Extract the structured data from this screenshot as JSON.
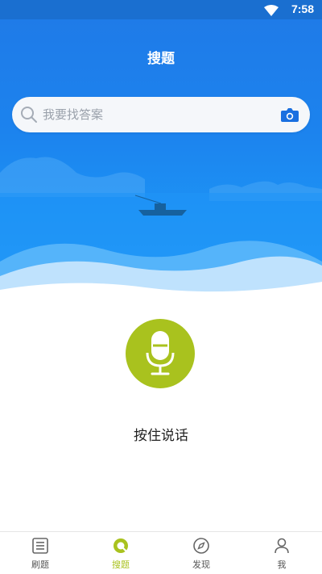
{
  "status_bar": {
    "time": "7:58"
  },
  "header": {
    "title": "搜题"
  },
  "search": {
    "placeholder": "我要找答案"
  },
  "voice": {
    "hint": "按住说话"
  },
  "tabs": [
    {
      "label": "刷题",
      "icon": "list-icon",
      "active": false
    },
    {
      "label": "搜题",
      "icon": "search-tab-icon",
      "active": true
    },
    {
      "label": "发现",
      "icon": "compass-icon",
      "active": false
    },
    {
      "label": "我",
      "icon": "user-icon",
      "active": false
    }
  ],
  "colors": {
    "primary": "#1a6fd0",
    "accent": "#a9c21e",
    "camera": "#1a6fe0"
  }
}
